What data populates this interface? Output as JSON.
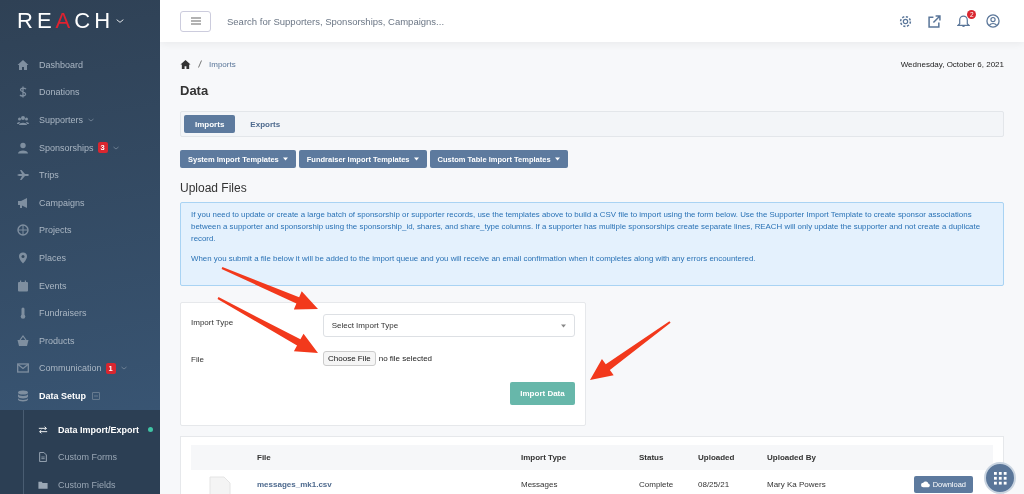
{
  "sidebar": {
    "logo": [
      {
        "text": "RE",
        "accent": false
      },
      {
        "text": "A",
        "accent": true
      },
      {
        "text": "CH",
        "accent": false
      }
    ],
    "items": [
      {
        "label": "Dashboard"
      },
      {
        "label": "Donations"
      },
      {
        "label": "Supporters",
        "expanded": false
      },
      {
        "label": "Sponsorships",
        "badge": "3",
        "expanded": false
      },
      {
        "label": "Trips"
      },
      {
        "label": "Campaigns"
      },
      {
        "label": "Projects"
      },
      {
        "label": "Places"
      },
      {
        "label": "Events"
      },
      {
        "label": "Fundraisers"
      },
      {
        "label": "Products"
      },
      {
        "label": "Communication",
        "badge": "1",
        "expanded": false
      },
      {
        "label": "Data Setup",
        "expanded": true,
        "children": [
          {
            "label": "Data Import/Export",
            "selected": true
          },
          {
            "label": "Custom Forms",
            "selected": false
          },
          {
            "label": "Custom Fields",
            "selected": false
          }
        ]
      }
    ]
  },
  "topbar": {
    "search": {
      "placeholder": "Search for Supporters, Sponsorships, Campaigns..."
    },
    "notification_count": "2"
  },
  "breadcrumb": [
    "Imports"
  ],
  "date": "Wednesday, October 6, 2021",
  "title": "Data",
  "tabs": [
    {
      "label": "Imports",
      "selected": true
    },
    {
      "label": "Exports",
      "selected": false
    }
  ],
  "template_buttons": [
    "System Import Templates",
    "Fundraiser Import Templates",
    "Custom Table Import Templates"
  ],
  "upload": {
    "heading": "Upload Files",
    "info": [
      "If you need to update or create a large batch of sponsorship or supporter records, use the templates above to build a CSV file to import using the form below. Use the Supporter Import Template to create sponsor associations between a supporter and sponsorship using the sponsorship_id, shares, and share_type columns. If a supporter has multiple sponsorships create separate lines, REACH will only update the supporter and not create a duplicate record.",
      "When you submit a file below it will be added to the import queue and you will receive an email confirmation when it completes along with any errors encountered."
    ],
    "form": {
      "import_type_label": "Import Type",
      "import_type_placeholder": "Select Import Type",
      "file_label": "File",
      "choose_file": "Choose File",
      "file_status": "no file selected",
      "submit": "Import Data"
    }
  },
  "table": {
    "columns": [
      "File",
      "Import Type",
      "Status",
      "Uploaded",
      "Uploaded By"
    ],
    "rows": [
      {
        "file": "messages_mk1.csv",
        "import_type": "Messages",
        "status": "Complete",
        "uploaded": "08/25/21",
        "uploaded_by": "Mary Ka Powers",
        "action": "Download"
      }
    ]
  }
}
